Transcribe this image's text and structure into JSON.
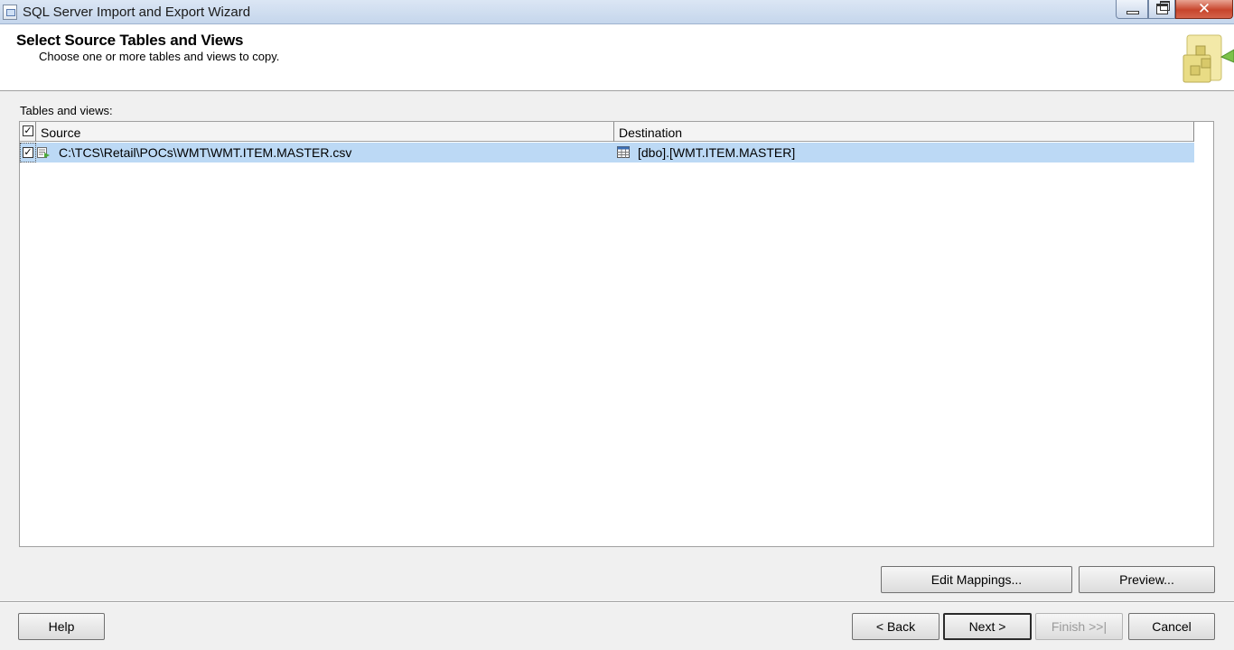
{
  "window": {
    "title": "SQL Server Import and Export Wizard",
    "close_glyph": "✕"
  },
  "header": {
    "title": "Select Source Tables and Views",
    "subtitle": "Choose one or more tables and views to copy."
  },
  "tables": {
    "label": "Tables and views:",
    "columns": {
      "source": "Source",
      "destination": "Destination"
    },
    "select_all_checked": true,
    "rows": [
      {
        "checked": true,
        "source": "C:\\TCS\\Retail\\POCs\\WMT\\WMT.ITEM.MASTER.csv",
        "destination": "[dbo].[WMT.ITEM.MASTER]",
        "source_icon": "flat-file-icon",
        "destination_icon": "table-icon"
      }
    ]
  },
  "buttons": {
    "edit_mappings": "Edit Mappings...",
    "preview": "Preview...",
    "help": "Help",
    "back": "< Back",
    "next": "Next >",
    "finish": "Finish >>|",
    "cancel": "Cancel"
  },
  "check_mark": "✓",
  "colors": {
    "selected_row": "#bcd9f5",
    "titlebar": "#c5d6ec",
    "close_button": "#c7452c"
  }
}
